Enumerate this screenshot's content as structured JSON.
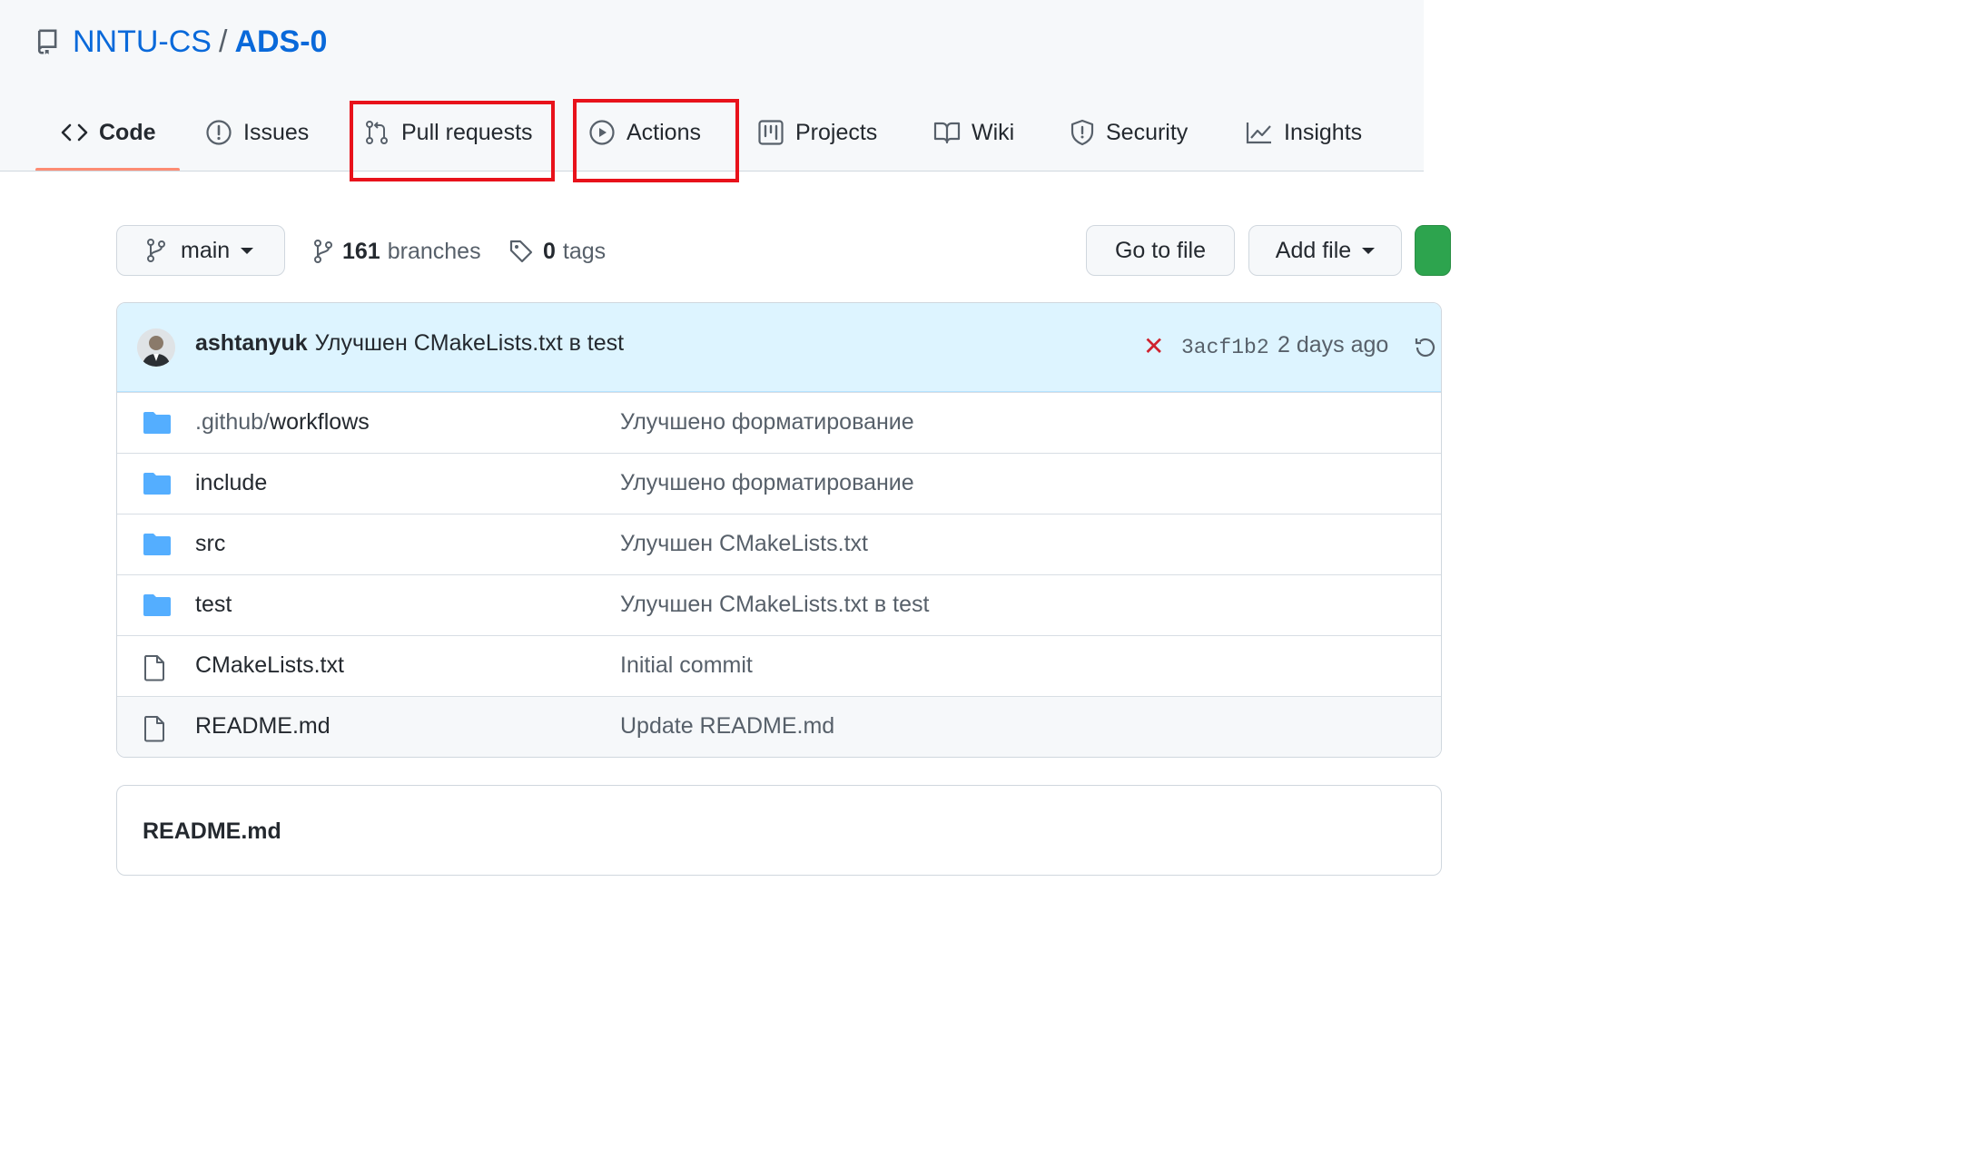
{
  "repo": {
    "owner": "NNTU-CS",
    "separator": "/",
    "name": "ADS-0"
  },
  "tabs": [
    {
      "label": "Code",
      "icon": "code-icon",
      "selected": true
    },
    {
      "label": "Issues",
      "icon": "issue-opened-icon"
    },
    {
      "label": "Pull requests",
      "icon": "git-pull-request-icon",
      "highlighted": true
    },
    {
      "label": "Actions",
      "icon": "play-icon",
      "highlighted": true
    },
    {
      "label": "Projects",
      "icon": "project-icon"
    },
    {
      "label": "Wiki",
      "icon": "book-icon"
    },
    {
      "label": "Security",
      "icon": "shield-icon"
    },
    {
      "label": "Insights",
      "icon": "graph-icon"
    }
  ],
  "toolbar": {
    "branch": "main",
    "branches_count": "161",
    "branches_label": "branches",
    "tags_count": "0",
    "tags_label": "tags",
    "go_to_file": "Go to file",
    "add_file": "Add file"
  },
  "latest_commit": {
    "author": "ashtanyuk",
    "message": "Улучшен CMakeLists.txt в test",
    "status": "failure",
    "sha": "3acf1b2",
    "time": "2 days ago"
  },
  "files": [
    {
      "type": "dir",
      "name_prefix": ".github/",
      "name": "workflows",
      "message": "Улучшено форматирование"
    },
    {
      "type": "dir",
      "name_prefix": "",
      "name": "include",
      "message": "Улучшено форматирование"
    },
    {
      "type": "dir",
      "name_prefix": "",
      "name": "src",
      "message": "Улучшен CMakeLists.txt"
    },
    {
      "type": "dir",
      "name_prefix": "",
      "name": "test",
      "message": "Улучшен CMakeLists.txt в test"
    },
    {
      "type": "file",
      "name_prefix": "",
      "name": "CMakeLists.txt",
      "message": "Initial commit"
    },
    {
      "type": "file",
      "name_prefix": "",
      "name": "README.md",
      "message": "Update README.md"
    }
  ],
  "readme": {
    "title": "README.md"
  },
  "colors": {
    "link": "#0969da",
    "selected_tab_underline": "#fd8c73",
    "highlight_box": "#e8121b",
    "commit_bar": "#ddf4ff",
    "folder": "#54aeff",
    "failure": "#cf222e"
  }
}
